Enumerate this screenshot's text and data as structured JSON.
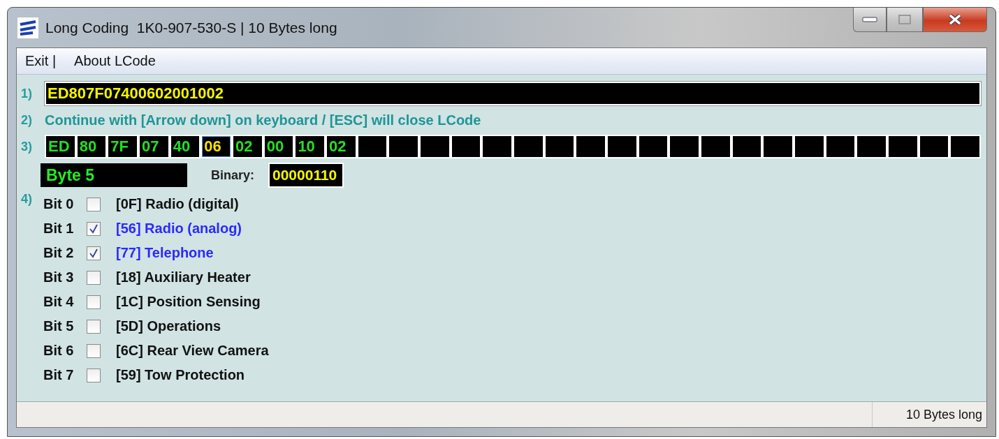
{
  "window": {
    "title": "Long Coding  1K0-907-530-S | 10 Bytes long"
  },
  "menu": [
    "Exit |",
    "About LCode"
  ],
  "step1": {
    "label": "1)",
    "value": "ED807F07400602001002"
  },
  "step2": {
    "label": "2)",
    "text": "Continue with [Arrow down] on keyboard / [ESC] will close LCode"
  },
  "step3": {
    "label": "3)",
    "cells": [
      {
        "value": "ED",
        "selected": false
      },
      {
        "value": "80",
        "selected": false
      },
      {
        "value": "7F",
        "selected": false
      },
      {
        "value": "07",
        "selected": false
      },
      {
        "value": "40",
        "selected": false
      },
      {
        "value": "06",
        "selected": true
      },
      {
        "value": "02",
        "selected": false
      },
      {
        "value": "00",
        "selected": false
      },
      {
        "value": "10",
        "selected": false
      },
      {
        "value": "02",
        "selected": false
      },
      {
        "selected": false
      },
      {
        "selected": false
      },
      {
        "selected": false
      },
      {
        "selected": false
      },
      {
        "selected": false
      },
      {
        "selected": false
      },
      {
        "selected": false
      },
      {
        "selected": false
      },
      {
        "selected": false
      },
      {
        "selected": false
      },
      {
        "selected": false
      },
      {
        "selected": false
      },
      {
        "selected": false
      },
      {
        "selected": false
      },
      {
        "selected": false
      },
      {
        "selected": false
      },
      {
        "selected": false
      },
      {
        "selected": false
      },
      {
        "selected": false
      },
      {
        "selected": false
      }
    ],
    "byte_label": "Byte 5",
    "binary_label": "Binary:",
    "binary_value": "00000110"
  },
  "step4": {
    "label": "4)",
    "bits": [
      {
        "bit": "Bit 0",
        "text": "[0F] Radio (digital)",
        "checked": false
      },
      {
        "bit": "Bit 1",
        "text": "[56] Radio (analog)",
        "checked": true
      },
      {
        "bit": "Bit 2",
        "text": "[77] Telephone",
        "checked": true
      },
      {
        "bit": "Bit 3",
        "text": "[18] Auxiliary Heater",
        "checked": false
      },
      {
        "bit": "Bit 4",
        "text": "[1C] Position Sensing",
        "checked": false
      },
      {
        "bit": "Bit 5",
        "text": "[5D] Operations",
        "checked": false
      },
      {
        "bit": "Bit 6",
        "text": "[6C] Rear View Camera",
        "checked": false
      },
      {
        "bit": "Bit 7",
        "text": "[59] Tow Protection",
        "checked": false
      }
    ]
  },
  "status_bar": {
    "text": "10 Bytes long"
  }
}
